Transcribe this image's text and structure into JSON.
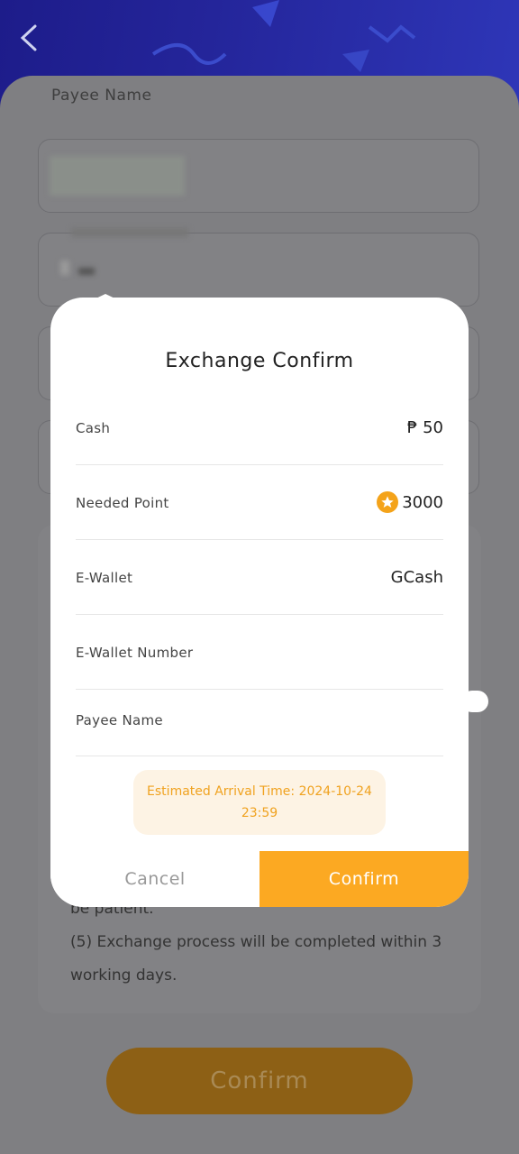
{
  "background": {
    "payee_label": "Payee Name",
    "notes": [
      "be patient.",
      "(5) Exchange process will be completed within 3",
      "working days."
    ],
    "confirm_label": "Confirm"
  },
  "dialog": {
    "title": "Exchange Confirm",
    "rows": [
      {
        "label": "Cash",
        "value": "₱ 50"
      },
      {
        "label": "Needed Point",
        "value": "3000"
      },
      {
        "label": "E-Wallet",
        "value": "GCash"
      },
      {
        "label": "E-Wallet Number",
        "value": ""
      },
      {
        "label": "Payee Name",
        "value": ""
      }
    ],
    "eta": "Estimated Arrival Time: 2024-10-24 23:59",
    "cancel_label": "Cancel",
    "confirm_label": "Confirm"
  },
  "colors": {
    "accent": "#fca922",
    "coin": "#f4a31a",
    "eta_text": "#f0a21f",
    "banner": "#24259a"
  },
  "icons": {
    "back": "chevron-left-icon",
    "coin": "star-coin-icon"
  }
}
